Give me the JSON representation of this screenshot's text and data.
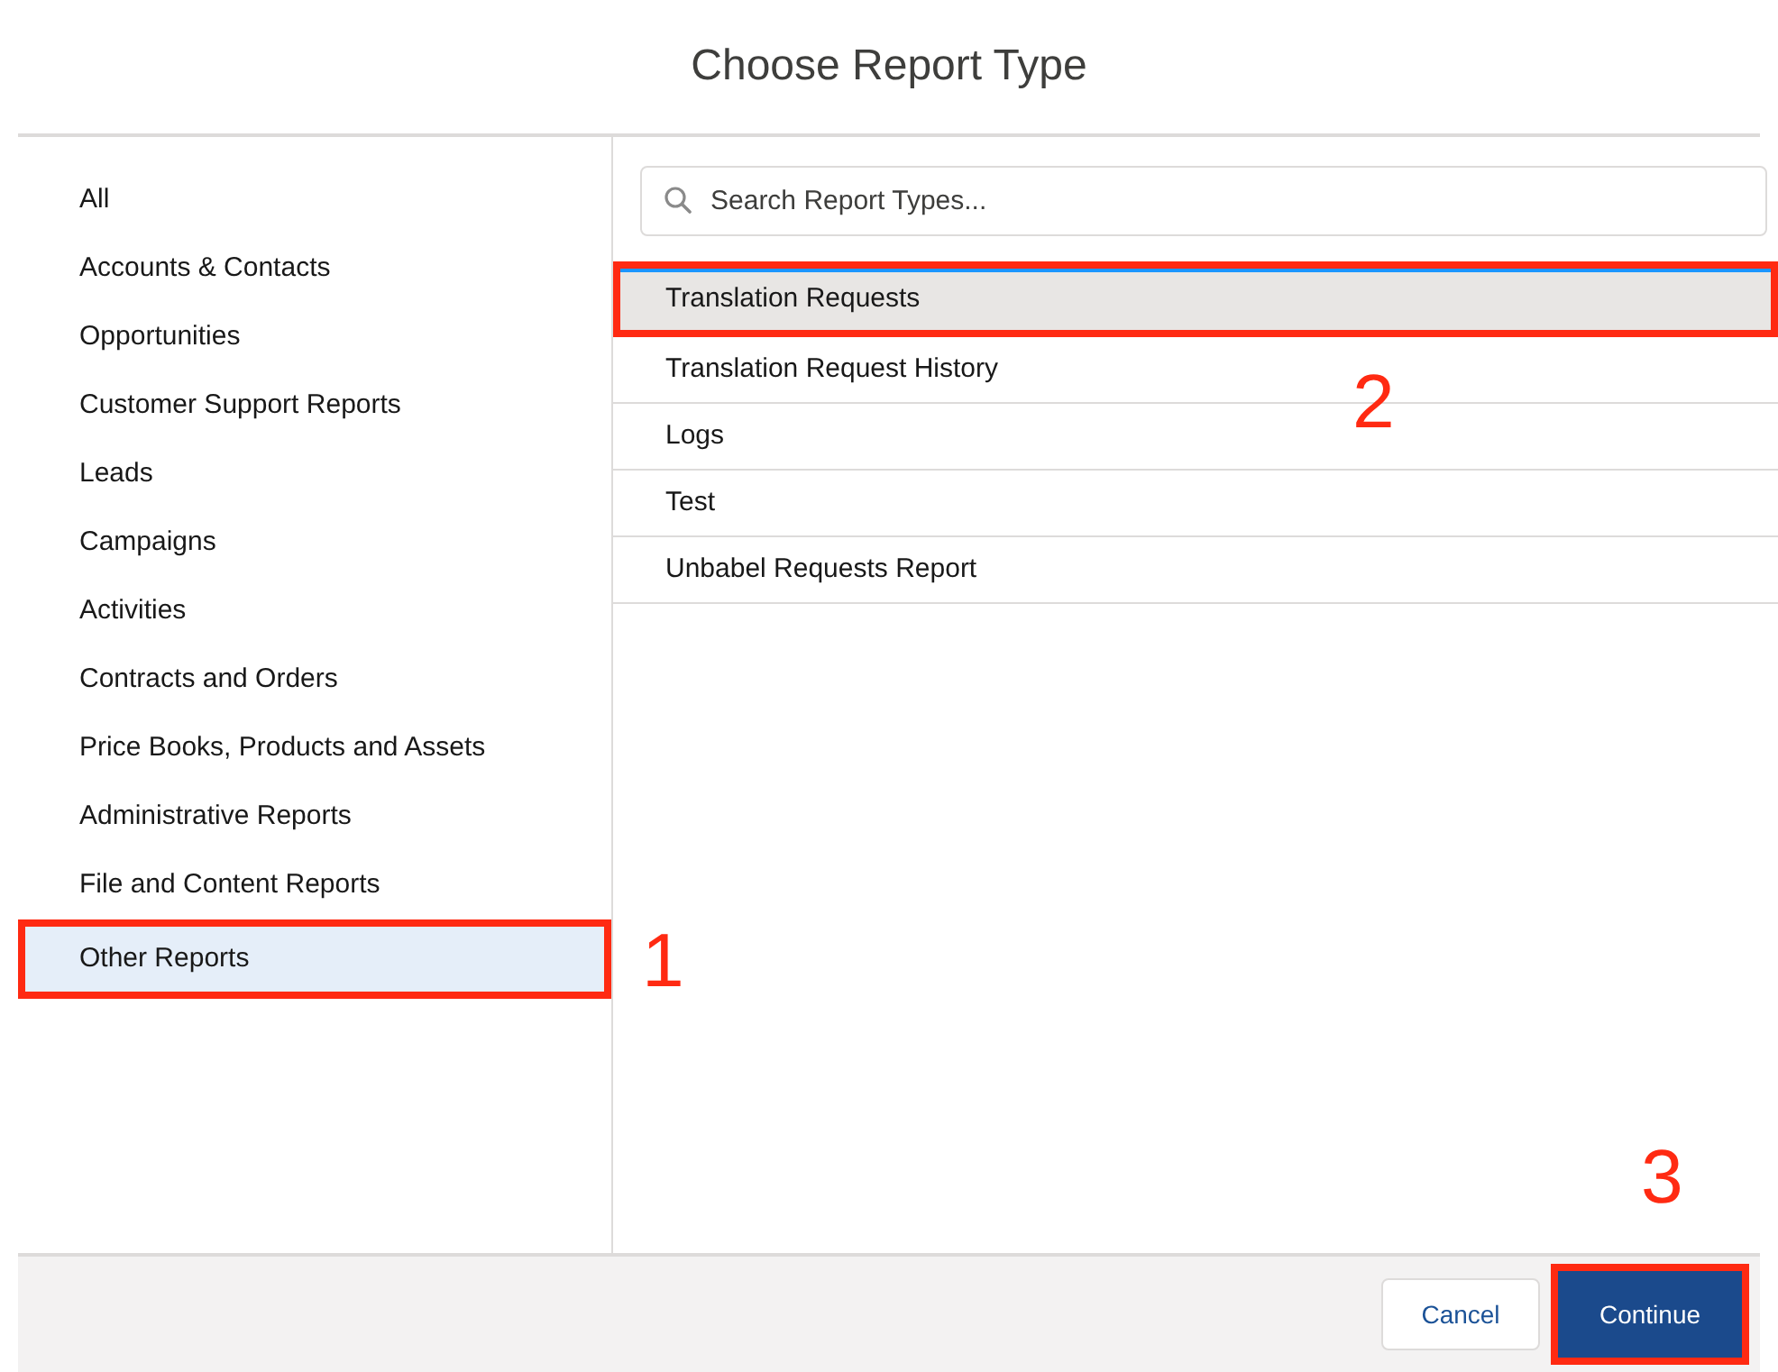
{
  "window": {
    "title": "Choose Report Type"
  },
  "categories": [
    {
      "label": "All",
      "selected": false,
      "highlighted": false
    },
    {
      "label": "Accounts & Contacts",
      "selected": false,
      "highlighted": false
    },
    {
      "label": "Opportunities",
      "selected": false,
      "highlighted": false
    },
    {
      "label": "Customer Support Reports",
      "selected": false,
      "highlighted": false
    },
    {
      "label": "Leads",
      "selected": false,
      "highlighted": false
    },
    {
      "label": "Campaigns",
      "selected": false,
      "highlighted": false
    },
    {
      "label": "Activities",
      "selected": false,
      "highlighted": false
    },
    {
      "label": "Contracts and Orders",
      "selected": false,
      "highlighted": false
    },
    {
      "label": "Price Books, Products and Assets",
      "selected": false,
      "highlighted": false
    },
    {
      "label": "Administrative Reports",
      "selected": false,
      "highlighted": false
    },
    {
      "label": "File and Content Reports",
      "selected": false,
      "highlighted": false
    },
    {
      "label": "Other Reports",
      "selected": true,
      "highlighted": true
    }
  ],
  "search": {
    "placeholder": "Search Report Types..."
  },
  "report_types": [
    {
      "label": "Translation Requests",
      "selected": true,
      "highlighted": true
    },
    {
      "label": "Translation Request History",
      "selected": false,
      "highlighted": false
    },
    {
      "label": "Logs",
      "selected": false,
      "highlighted": false
    },
    {
      "label": "Test",
      "selected": false,
      "highlighted": false
    },
    {
      "label": "Unbabel Requests Report",
      "selected": false,
      "highlighted": false
    }
  ],
  "buttons": [
    {
      "label": "Cancel",
      "kind": "neutral",
      "highlighted": false
    },
    {
      "label": "Continue",
      "kind": "brand",
      "highlighted": true
    }
  ],
  "annotations": [
    "1",
    "2",
    "3"
  ]
}
